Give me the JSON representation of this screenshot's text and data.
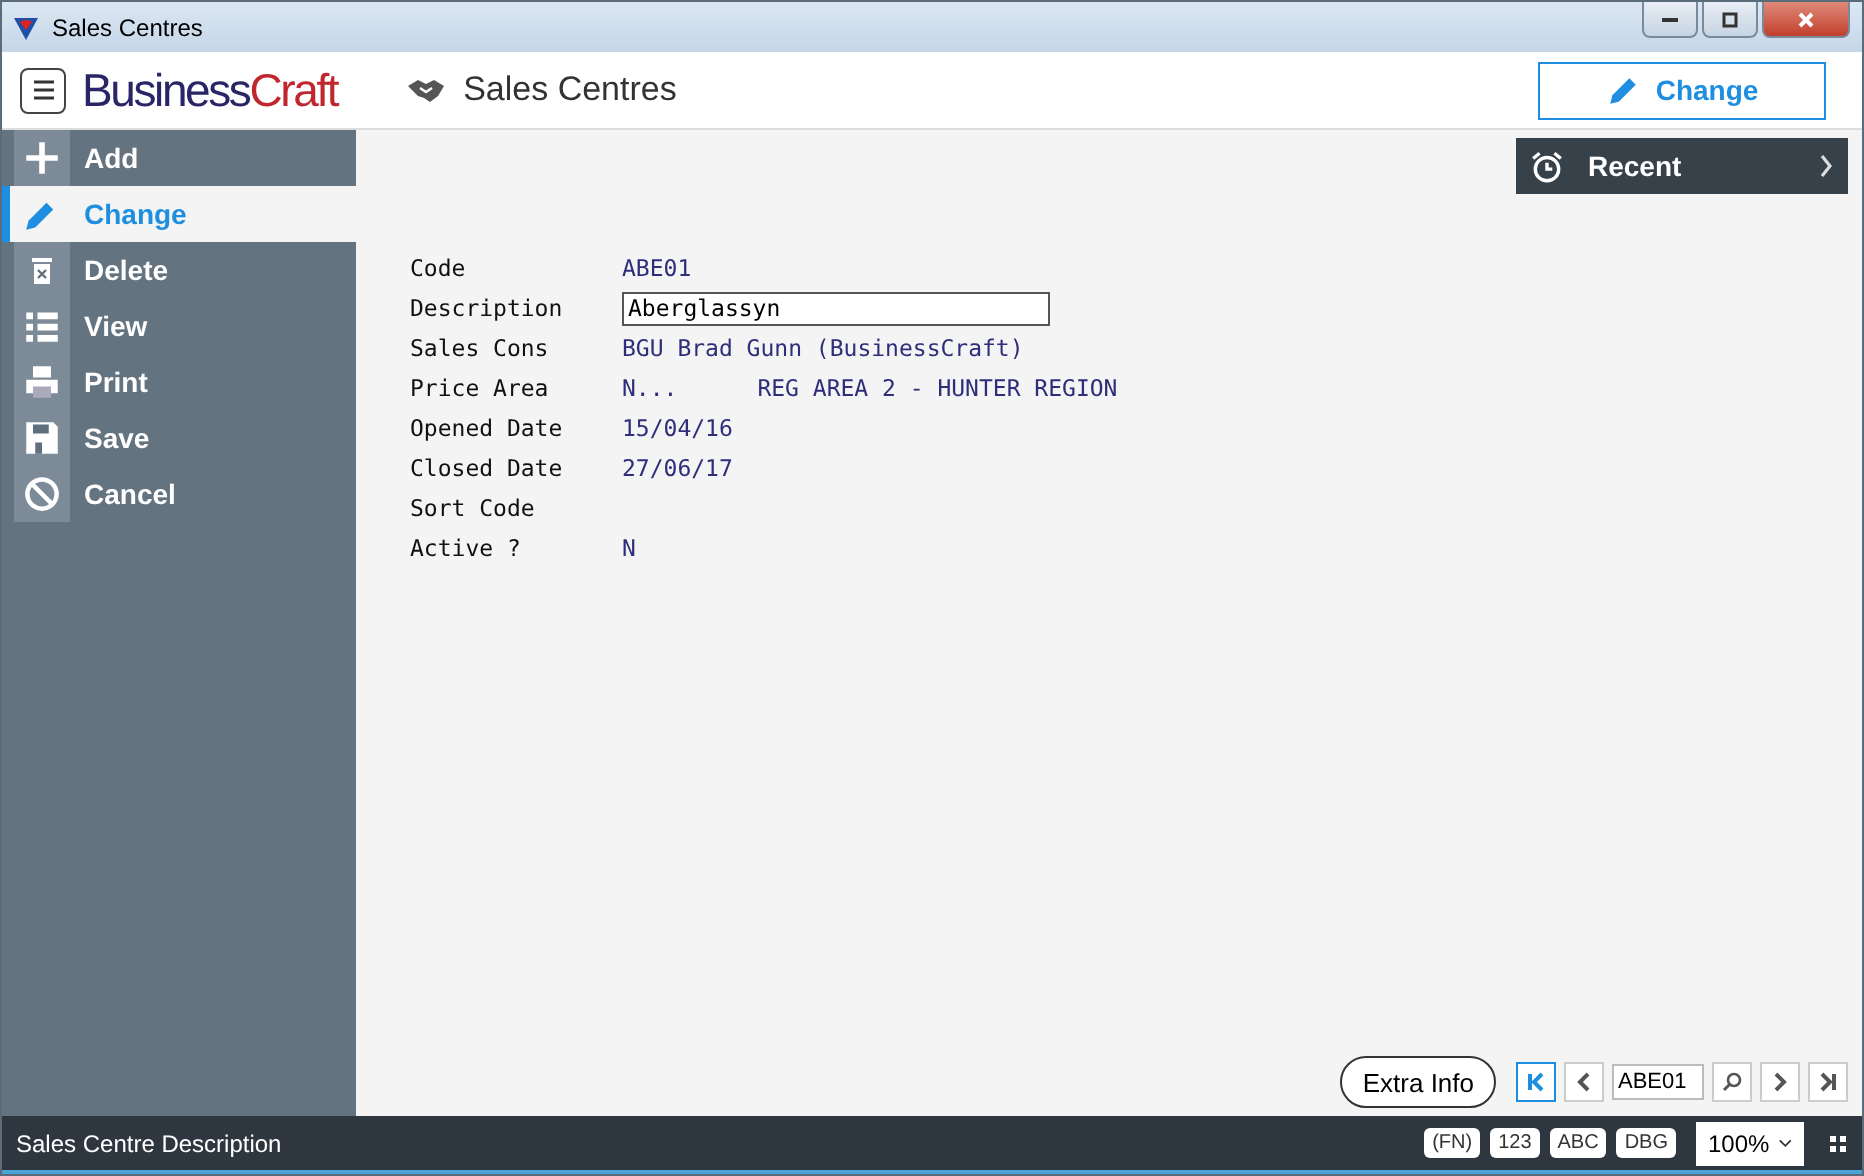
{
  "window": {
    "title": "Sales Centres"
  },
  "header": {
    "brand_first": "Business",
    "brand_second": "Craft",
    "page_title": "Sales Centres",
    "action_button": "Change"
  },
  "sidebar": {
    "items": [
      {
        "label": "Add",
        "selected": false
      },
      {
        "label": "Change",
        "selected": true
      },
      {
        "label": "Delete",
        "selected": false
      },
      {
        "label": "View",
        "selected": false
      },
      {
        "label": "Print",
        "selected": false
      },
      {
        "label": "Save",
        "selected": false
      },
      {
        "label": "Cancel",
        "selected": false
      }
    ]
  },
  "recent": {
    "label": "Recent"
  },
  "form": {
    "fields": [
      {
        "label": "Code",
        "kind": "text",
        "values": [
          "ABE01"
        ]
      },
      {
        "label": "Description",
        "kind": "input",
        "values": [
          "Aberglassyn"
        ]
      },
      {
        "label": "Sales Cons",
        "kind": "text",
        "values": [
          "BGU Brad Gunn (BusinessCraft)"
        ]
      },
      {
        "label": "Price Area",
        "kind": "text",
        "values": [
          "N...",
          "REG AREA 2 - HUNTER REGION"
        ]
      },
      {
        "label": "Opened Date",
        "kind": "text",
        "values": [
          "15/04/16"
        ]
      },
      {
        "label": "Closed Date",
        "kind": "text",
        "values": [
          "27/06/17"
        ]
      },
      {
        "label": "Sort Code",
        "kind": "text"
      },
      {
        "label": "Active ?",
        "kind": "text",
        "values": [
          "N"
        ]
      }
    ]
  },
  "navigator": {
    "extra_info": "Extra Info",
    "record": "ABE01"
  },
  "status_bar": {
    "message": "Sales Centre Description",
    "indicators": [
      "(FN)",
      "123",
      "ABC",
      "DBG"
    ],
    "zoom": "100%"
  }
}
